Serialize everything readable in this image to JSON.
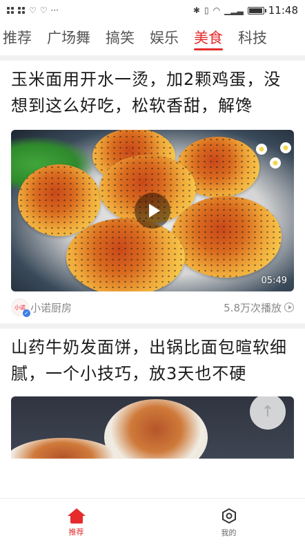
{
  "status_bar": {
    "time": "11:48",
    "left_icons": [
      "grid-icon",
      "grid-icon",
      "heart-pulse-icon",
      "heart-pulse-icon",
      "more-dots-icon"
    ],
    "right_icons": [
      "bluetooth-icon",
      "vibrate-icon",
      "wifi-icon",
      "signal-icon",
      "battery-icon"
    ],
    "more": "···"
  },
  "tabs": [
    {
      "label": "推荐",
      "active": false
    },
    {
      "label": "广场舞",
      "active": false
    },
    {
      "label": "搞笑",
      "active": false
    },
    {
      "label": "娱乐",
      "active": false
    },
    {
      "label": "美食",
      "active": true
    },
    {
      "label": "科技",
      "active": false
    }
  ],
  "accent_color": "#e52b2b",
  "feed": [
    {
      "title": "玉米面用开水一烫，加2颗鸡蛋，没想到这么好吃，松软香甜，解馋",
      "duration": "05:49",
      "author": "小诺厨房",
      "avatar_text": "小诺",
      "plays": "5.8万次播放"
    },
    {
      "title": "山药牛奶发面饼，出锅比面包暄软细腻，一个小技巧，放3天也不硬"
    }
  ],
  "scroll_top_icon": "arrow-up-icon",
  "bottom_nav": [
    {
      "label": "推荐",
      "icon": "home-icon",
      "active": true
    },
    {
      "label": "我的",
      "icon": "hexagon-icon",
      "active": false
    }
  ]
}
